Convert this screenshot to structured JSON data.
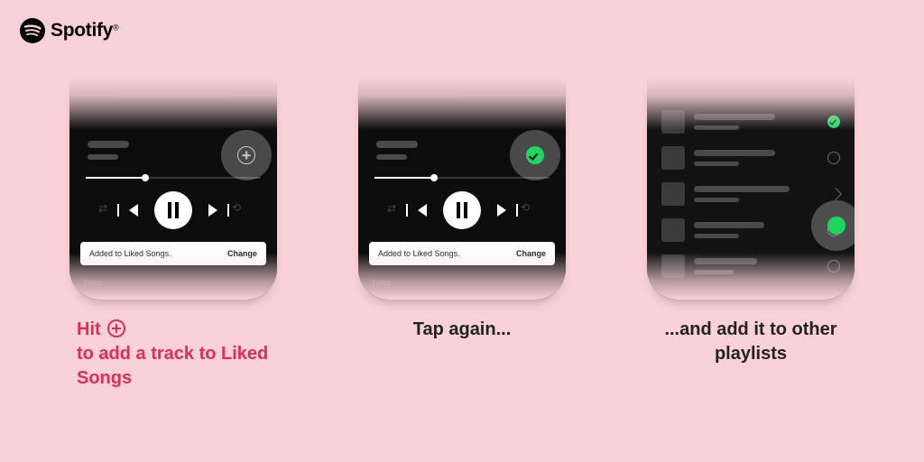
{
  "brand": {
    "name": "Spotify"
  },
  "toast": {
    "message": "Added to Liked Songs.",
    "action": "Change"
  },
  "labels": {
    "lyrics": "Lyrics"
  },
  "captions": {
    "step1_prefix": "Hit",
    "step1_rest": "to add a track to Liked Songs",
    "step2": "Tap again...",
    "step3": "...and add it to other playlists"
  }
}
